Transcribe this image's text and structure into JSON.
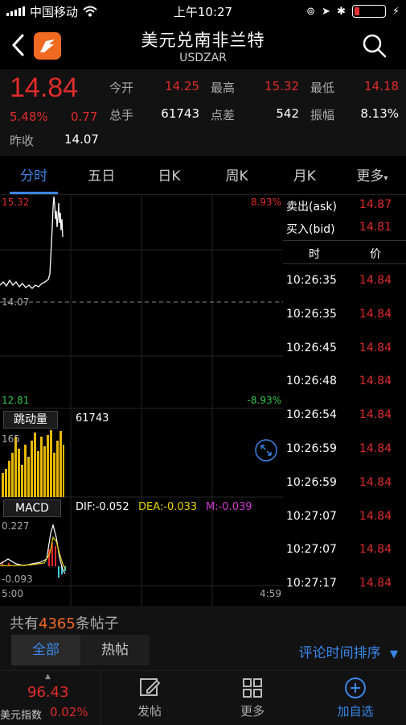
{
  "status": {
    "carrier": "中国移动",
    "time": "上午10:27"
  },
  "header": {
    "title": "美元兑南非兰特",
    "subtitle": "USDZAR"
  },
  "quote": {
    "price": "14.84",
    "pct": "5.48%",
    "change": "0.77",
    "prev_close_label": "昨收",
    "prev_close": "14.07",
    "stats": [
      {
        "label": "今开",
        "value": "14.25",
        "color": "#e02b2b"
      },
      {
        "label": "最高",
        "value": "15.32",
        "color": "#e02b2b"
      },
      {
        "label": "最低",
        "value": "14.18",
        "color": "#e02b2b"
      },
      {
        "label": "总手",
        "value": "61743",
        "color": "#ffffff"
      },
      {
        "label": "点差",
        "value": "542",
        "color": "#ffffff"
      },
      {
        "label": "振幅",
        "value": "8.13%",
        "color": "#ffffff"
      }
    ]
  },
  "tabs": [
    "分时",
    "五日",
    "日K",
    "周K",
    "月K",
    "更多"
  ],
  "chart": {
    "high": "15.32",
    "high_pct": "8.93%",
    "base": "14.07",
    "low": "12.81",
    "low_pct": "-8.93%",
    "volume_label": "跳动量",
    "volume_value": "61743",
    "volume_max": "165",
    "macd_label": "MACD",
    "dif": "DIF:-0.052",
    "dea": "DEA:-0.033",
    "m": "M:-0.039",
    "macd_top": "0.227",
    "macd_bottom": "-0.093",
    "time_start": "5:00",
    "time_end": "4:59"
  },
  "side": {
    "ask_label": "卖出(ask)",
    "ask_value": "14.87",
    "bid_label": "买入(bid)",
    "bid_value": "14.81",
    "col_time": "时",
    "col_price": "价",
    "trades": [
      {
        "time": "10:26:35",
        "price": "14.84"
      },
      {
        "time": "10:26:35",
        "price": "14.84"
      },
      {
        "time": "10:26:45",
        "price": "14.84"
      },
      {
        "time": "10:26:48",
        "price": "14.84"
      },
      {
        "time": "10:26:54",
        "price": "14.84"
      },
      {
        "time": "10:26:59",
        "price": "14.84"
      },
      {
        "time": "10:26:59",
        "price": "14.84"
      },
      {
        "time": "10:27:07",
        "price": "14.84"
      },
      {
        "time": "10:27:07",
        "price": "14.84"
      },
      {
        "time": "10:27:17",
        "price": "14.84"
      }
    ]
  },
  "posts": {
    "prefix": "共有",
    "count": "4365",
    "suffix": "条帖子",
    "tab_all": "全部",
    "tab_hot": "热帖",
    "sort": "评论时间排序"
  },
  "bottom_nav": {
    "index_price": "96.43",
    "index_name": "美元指数",
    "index_pct": "0.02%",
    "post": "发帖",
    "more": "更多",
    "add": "加自选"
  }
}
